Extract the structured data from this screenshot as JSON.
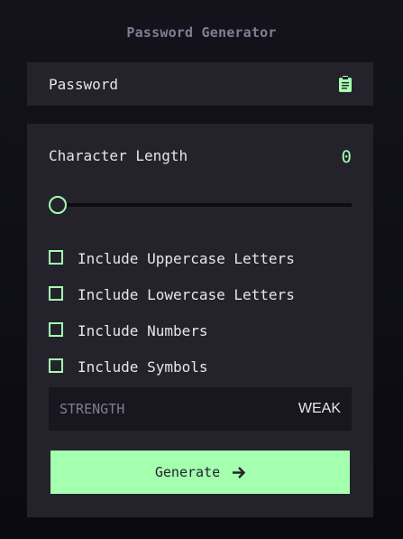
{
  "app": {
    "title": "Password Generator"
  },
  "password": {
    "placeholder": "Password"
  },
  "icons": {
    "copy": "clipboard-icon",
    "generate_arrow": "arrow-right-icon"
  },
  "length": {
    "label": "Character Length",
    "value": "0",
    "slider_fraction": 0
  },
  "options": [
    {
      "label": "Include Uppercase Letters",
      "checked": false
    },
    {
      "label": "Include Lowercase Letters",
      "checked": false
    },
    {
      "label": "Include Numbers",
      "checked": false
    },
    {
      "label": "Include Symbols",
      "checked": false
    }
  ],
  "strength": {
    "label": "STRENGTH",
    "value": "WEAK"
  },
  "generate": {
    "label": "Generate"
  },
  "colors": {
    "accent": "#a4ffaf",
    "panel": "#24232c",
    "muted": "#817d92",
    "text": "#e6e5ea",
    "dark": "#18171f"
  }
}
